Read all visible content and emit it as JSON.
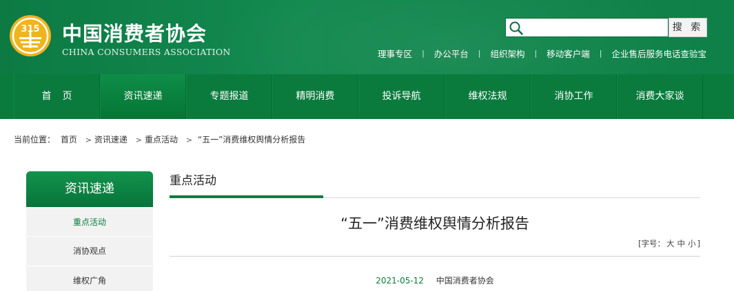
{
  "header": {
    "brand_cn": "中国消费者协会",
    "brand_en": "CHINA CONSUMERS ASSOCIATION",
    "logo_text": "315",
    "search": {
      "placeholder": "",
      "button_label": "搜 索"
    },
    "top_links": [
      "理事专区",
      "办公平台",
      "组织架构",
      "移动客户端",
      "企业售后服务电话查验宝"
    ],
    "colors": {
      "brand_green": "#0a7b3d",
      "header_green": "#12894f"
    }
  },
  "nav": {
    "items": [
      "首页",
      "资讯速递",
      "专题报道",
      "精明消费",
      "投诉导航",
      "维权法规",
      "消协工作",
      "消费大家谈"
    ],
    "active_index": 1
  },
  "breadcrumb": {
    "label": "当前位置：",
    "items": [
      "首页",
      "资讯速递",
      "重点活动",
      "“五一”消费维权舆情分析报告"
    ]
  },
  "sidebar": {
    "title": "资讯速递",
    "items": [
      "重点活动",
      "消协观点",
      "维权广角"
    ],
    "active_index": 0
  },
  "main": {
    "section_title": "重点活动",
    "article": {
      "title": "“五一”消费维权舆情分析报告",
      "font_size_prefix": "[字号：",
      "font_sizes": [
        "大",
        "中",
        "小"
      ],
      "font_size_suffix": "]",
      "date": "2021-05-12",
      "source": "中国消费者协会"
    }
  }
}
